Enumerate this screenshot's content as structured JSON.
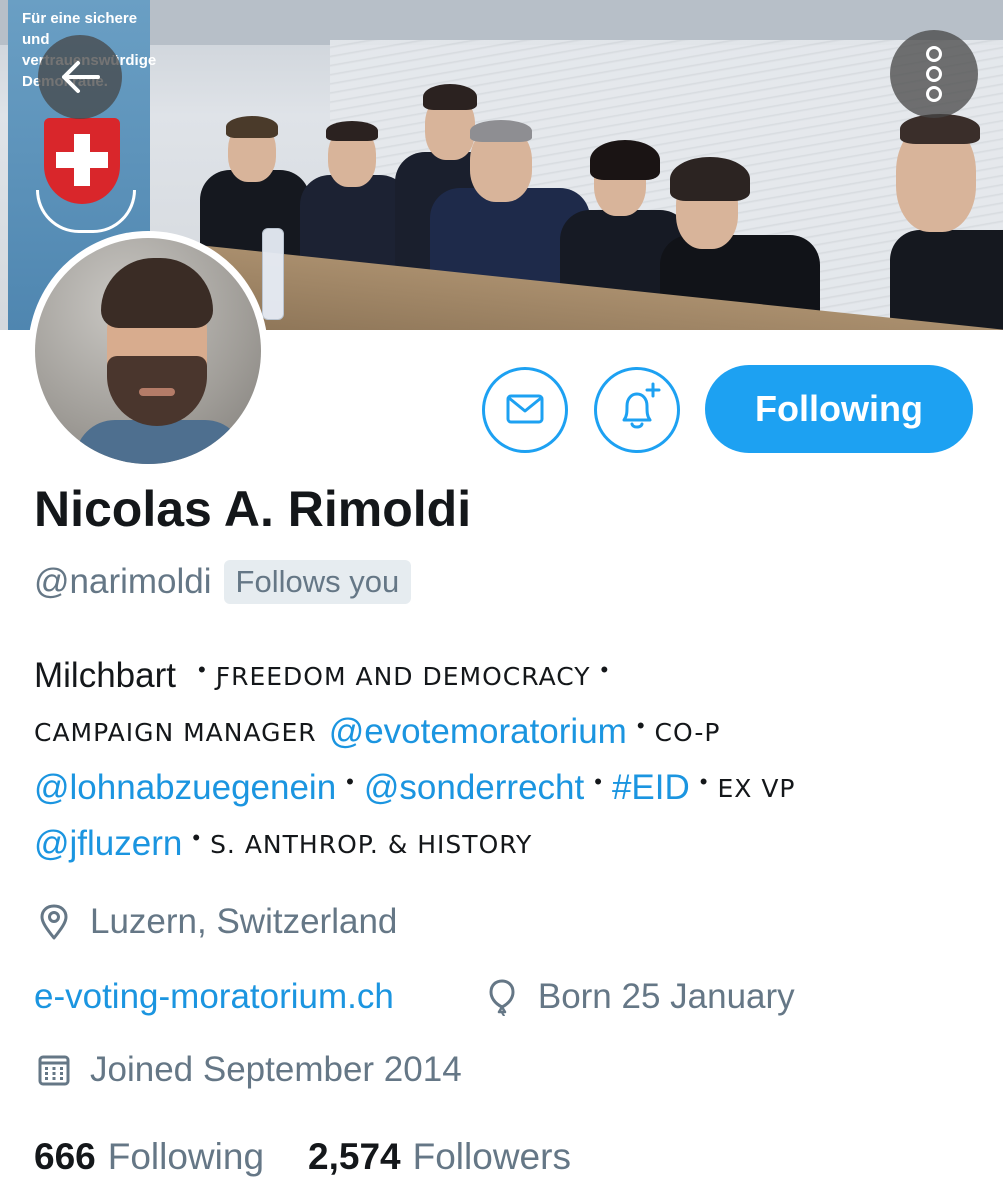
{
  "banner": {
    "poster_text": "Für eine sichere und vertrauenswürdige Demokratie."
  },
  "profile": {
    "display_name": "Nicolas A. Rimoldi",
    "handle": "@narimoldi",
    "follows_you_badge": "Follows you",
    "follow_button_label": "Following"
  },
  "bio": {
    "line1": {
      "text": "Milchbart",
      "caps": "ƑREEDOM AND DEMOCRACY"
    },
    "line2": {
      "caps1": "CAMPAIGN MANAGER",
      "link": "@evotemoratorium",
      "caps2": "CO-P"
    },
    "line3": {
      "link1": "@lohnabzuegenein",
      "link2": "@sonderrecht",
      "link3": "#EID",
      "caps": "EX VP"
    },
    "line4": {
      "link": "@jfluzern",
      "caps": "S. ANTHROP. & HISTORY"
    },
    "separator": "•"
  },
  "meta": {
    "location": "Luzern, Switzerland",
    "website": "e-voting-moratorium.ch",
    "birthday": "Born 25 January",
    "joined": "Joined September 2014"
  },
  "stats": {
    "following_count": "666",
    "following_label": "Following",
    "followers_count": "2,574",
    "followers_label": "Followers"
  },
  "icons": {
    "back": "arrow-left-icon",
    "more": "vertical-ellipsis-icon",
    "message": "envelope-icon",
    "notify": "bell-plus-icon",
    "location": "location-pin-icon",
    "birthday": "balloon-icon",
    "joined": "calendar-icon"
  },
  "colors": {
    "accent": "#1da1f2",
    "link": "#1b95e0",
    "secondary_text": "#657786",
    "primary_text": "#14171a"
  }
}
